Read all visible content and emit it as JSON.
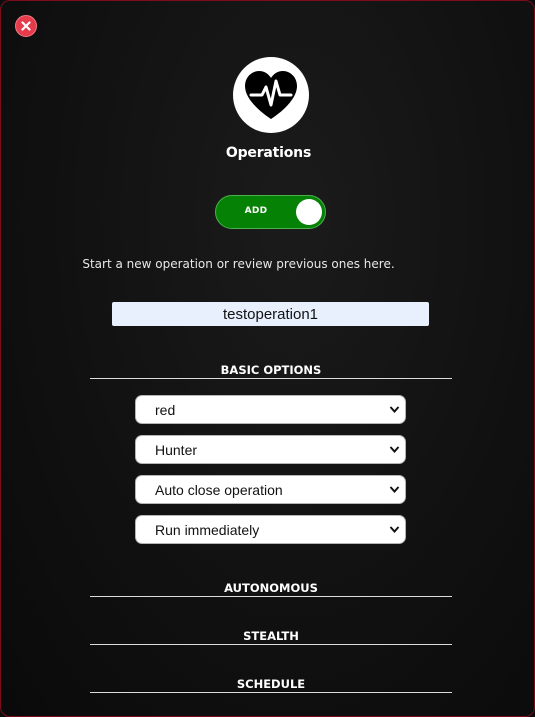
{
  "header": {
    "title": "Operations",
    "close_icon": "close-x-icon",
    "logo_icon": "heart-pulse-icon"
  },
  "toggle": {
    "label": "ADD",
    "state": "on",
    "color": "#058105"
  },
  "subtitle": "Start a new operation or review previous ones here.",
  "operation_name": {
    "value": "testoperation1"
  },
  "sections": {
    "basic_options": "BASIC OPTIONS",
    "autonomous": "AUTONOMOUS",
    "stealth": "STEALTH",
    "schedule": "SCHEDULE"
  },
  "basic_options": {
    "selects": [
      {
        "value": "red"
      },
      {
        "value": "Hunter"
      },
      {
        "value": "Auto close operation"
      },
      {
        "value": "Run immediately"
      }
    ]
  },
  "colors": {
    "panel_border": "#7a0c1c",
    "close_button": "#e63b4a",
    "input_background": "#e8f0fe"
  }
}
